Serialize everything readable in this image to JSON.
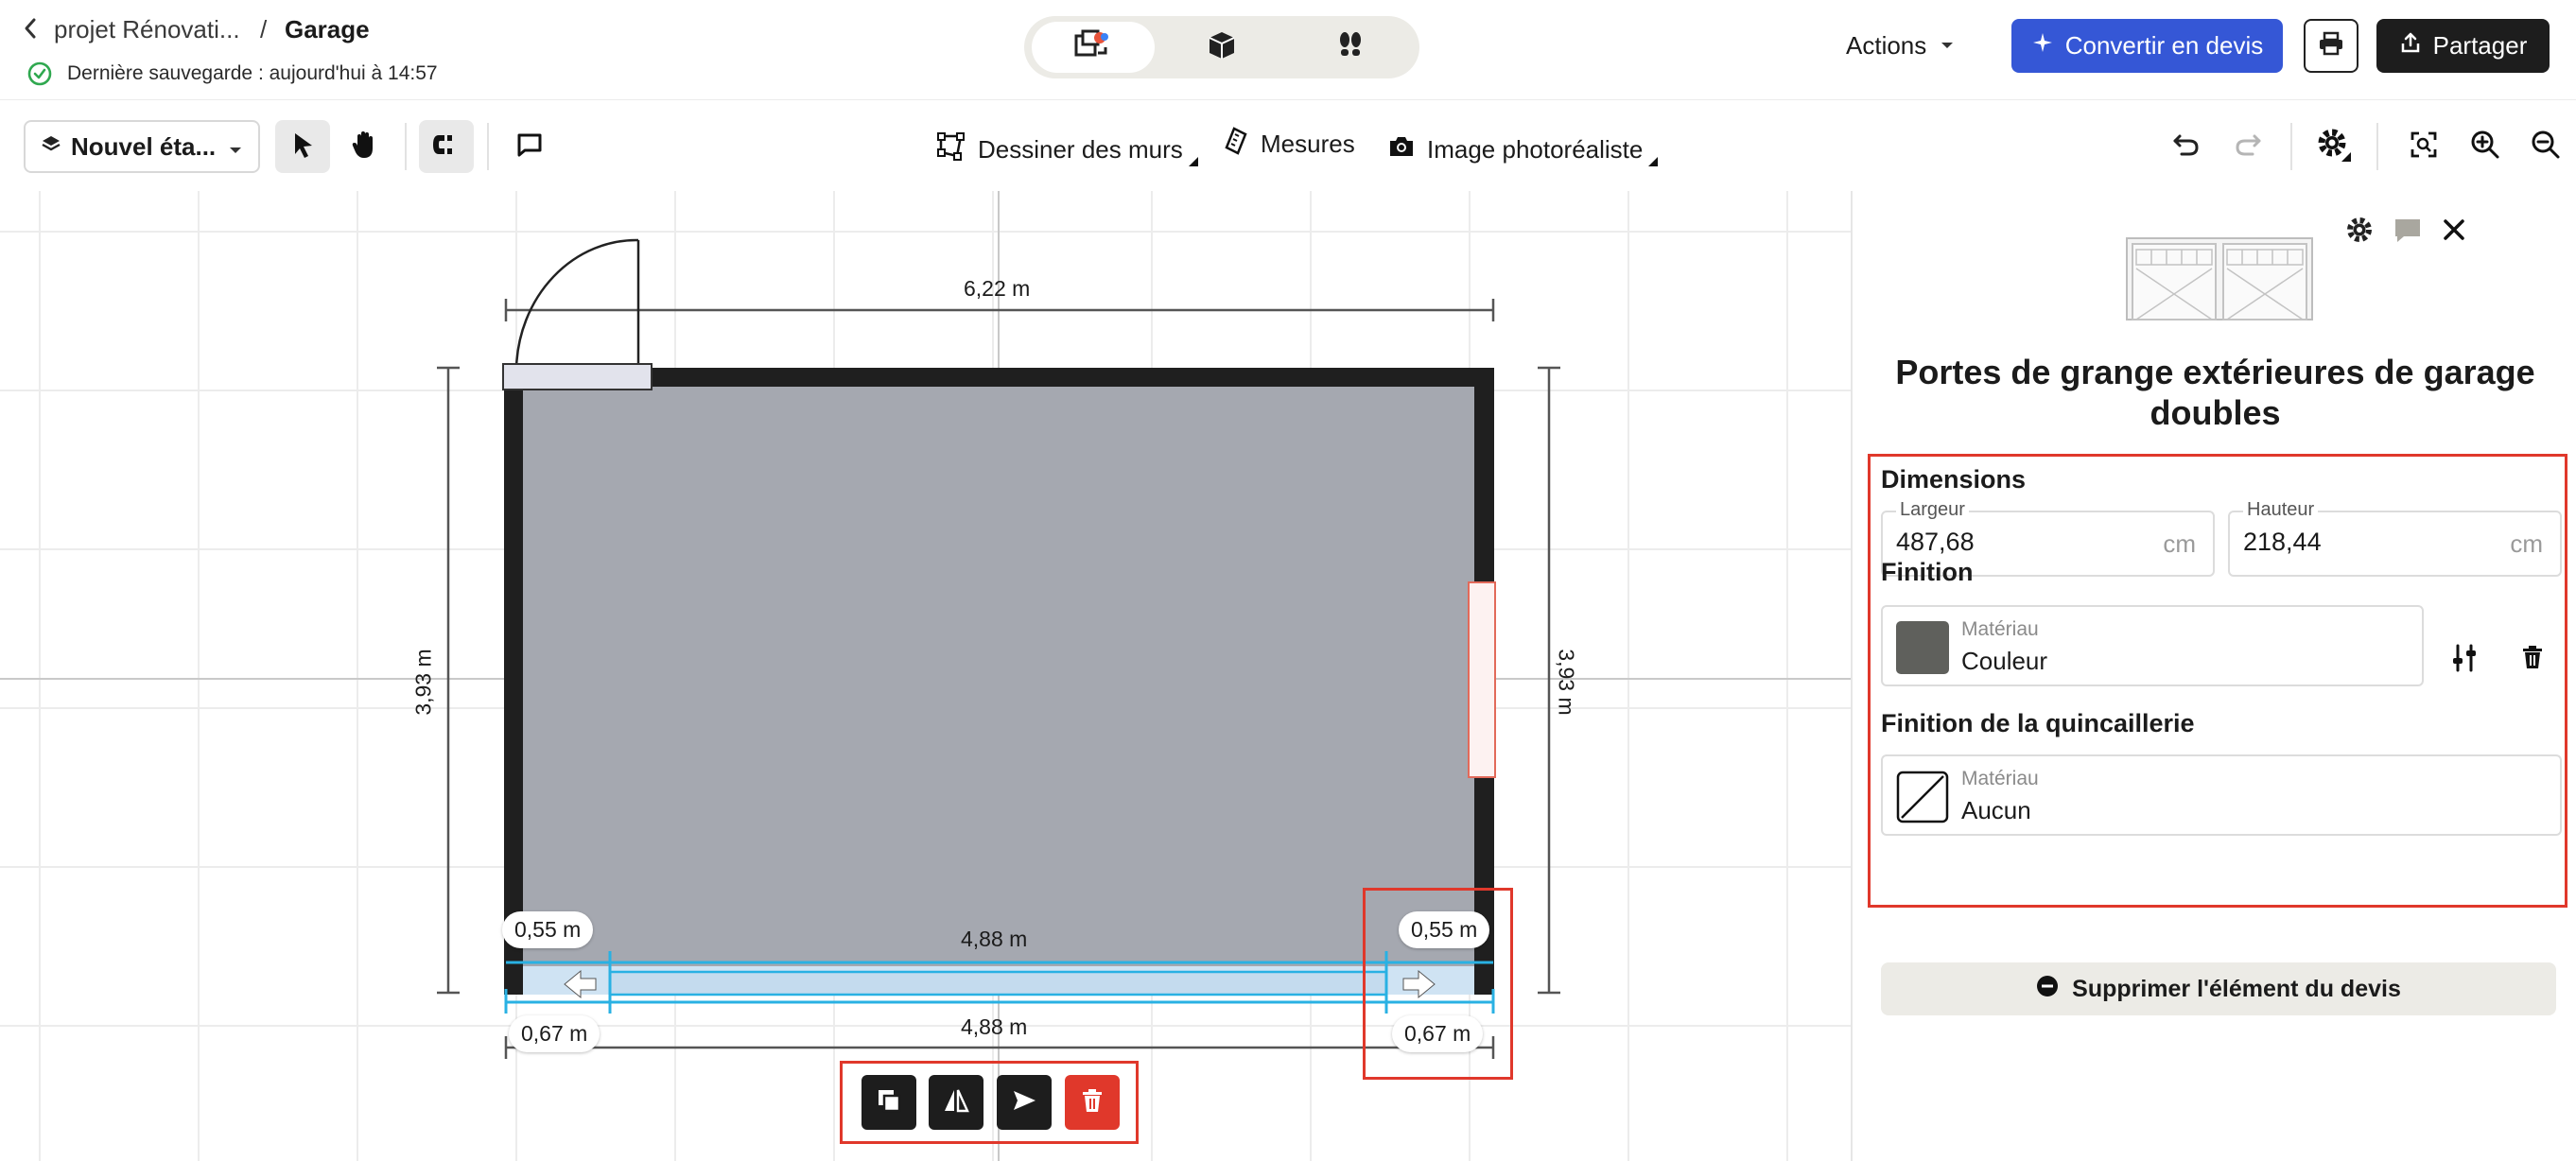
{
  "header": {
    "back_label": "projet Rénovati...",
    "separator": "/",
    "current_room": "Garage",
    "save_status": "Dernière sauvegarde : aujourd'hui à 14:57",
    "actions_label": "Actions",
    "convert_label": "Convertir en devis",
    "share_label": "Partager",
    "view_modes": [
      "plan-2d-icon",
      "cube-3d-icon",
      "walk-footsteps-icon"
    ],
    "active_view": 0
  },
  "toolbar": {
    "floor_select": "Nouvel éta...",
    "draw_walls": "Dessiner des murs",
    "measures": "Mesures",
    "photoreal": "Image photoréaliste"
  },
  "canvas": {
    "top_width": "6,22 m",
    "left_height": "3,93 m",
    "right_height": "3,93 m",
    "door_width_inner": "4,88 m",
    "door_width_outer": "4,88 m",
    "offset_left_top": "0,55 m",
    "offset_right_top": "0,55 m",
    "offset_left_bottom": "0,67 m",
    "offset_right_bottom": "0,67 m",
    "actions": [
      "duplicate-icon",
      "flip-icon",
      "send-icon",
      "trash-icon"
    ],
    "colors": {
      "wall": "#1f1f1f",
      "floor": "#a5a8b0",
      "selection": "#29b1e3",
      "highlight": "#e0382b"
    }
  },
  "panel": {
    "title": "Portes de grange extérieures de garage doubles",
    "dimensions_heading": "Dimensions",
    "width_label": "Largeur",
    "width_value": "487,68",
    "width_unit": "cm",
    "height_label": "Hauteur",
    "height_value": "218,44",
    "height_unit": "cm",
    "finish_heading": "Finition",
    "finish_material_label": "Matériau",
    "finish_material_value": "Couleur",
    "finish_color": "#5f605c",
    "hardware_heading": "Finition de la quincaillerie",
    "hardware_material_label": "Matériau",
    "hardware_material_value": "Aucun",
    "remove_label": "Supprimer l'élément du devis"
  }
}
